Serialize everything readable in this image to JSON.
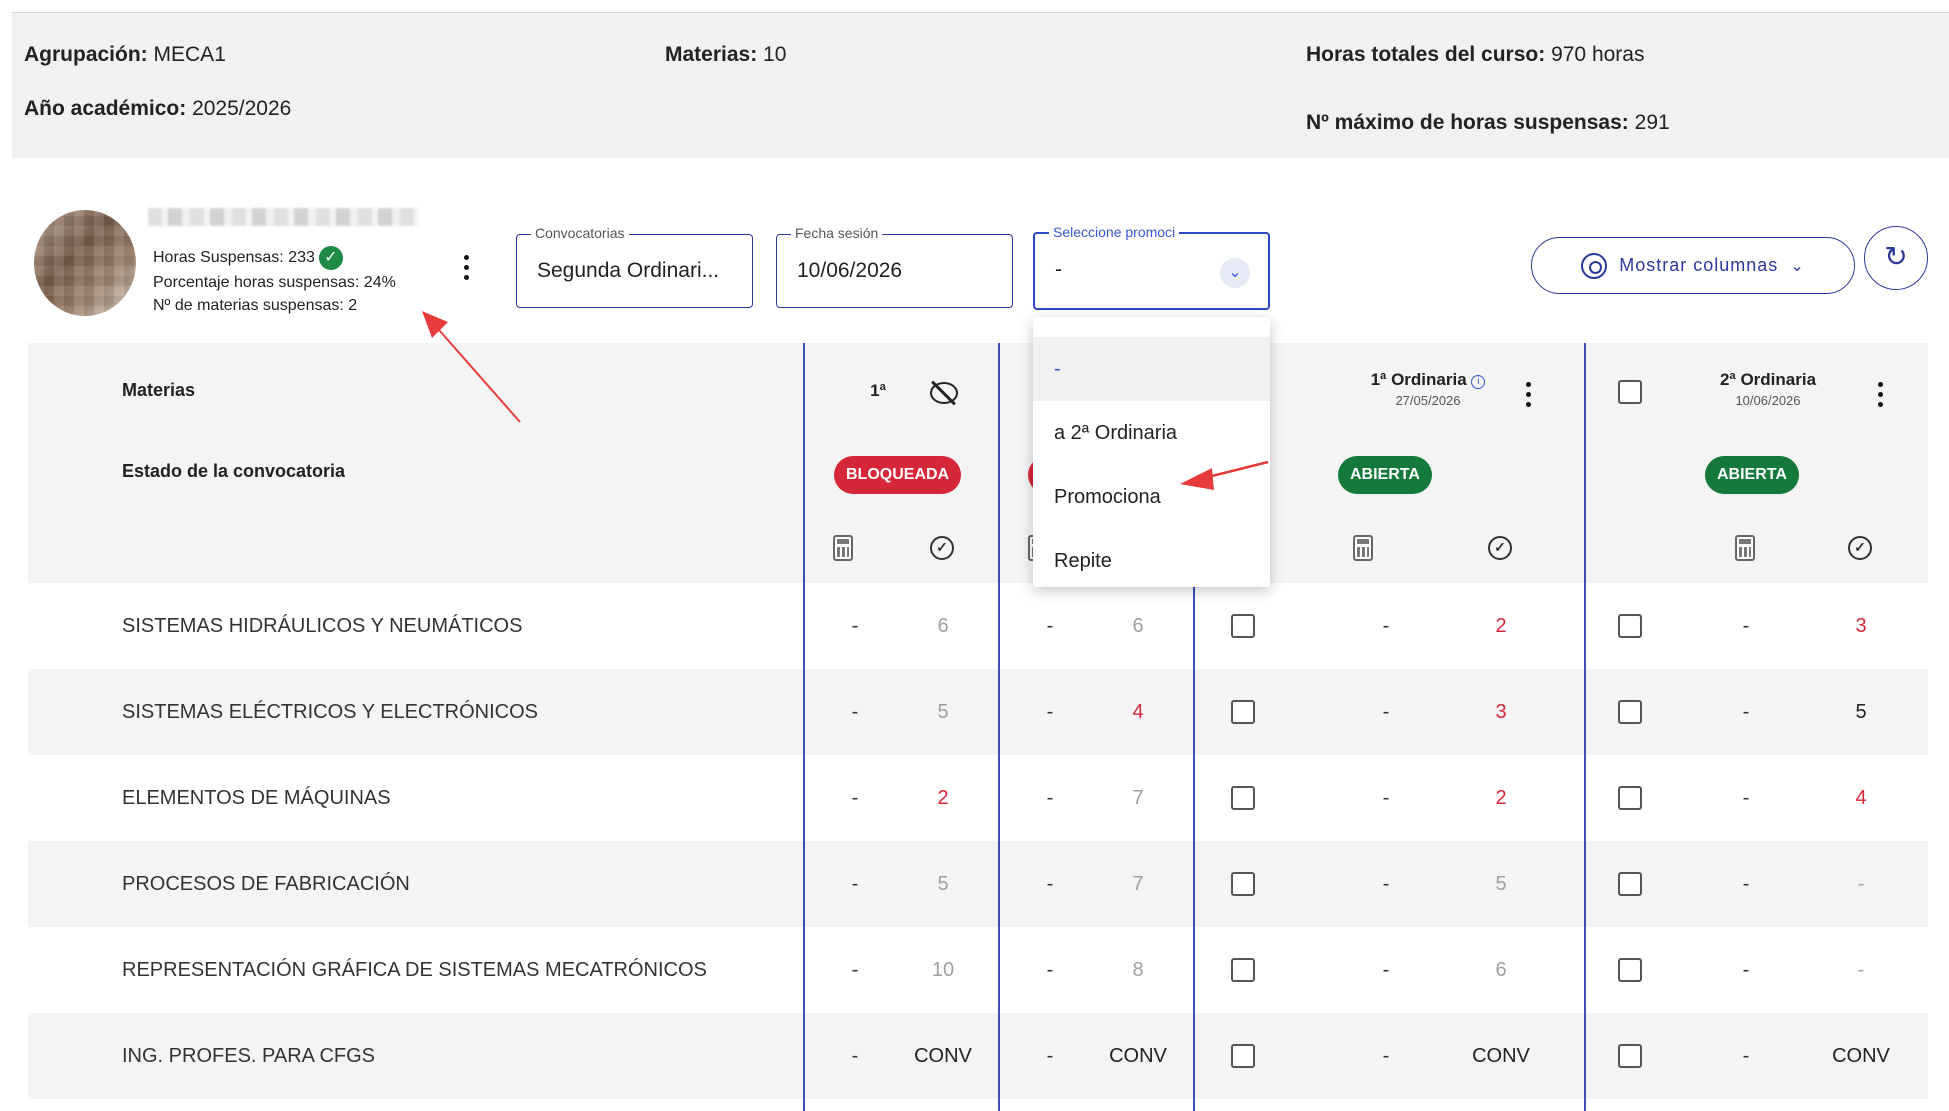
{
  "info": {
    "agrupacion_label": "Agrupación:",
    "agrupacion_value": "MECA1",
    "anio_label": "Año académico:",
    "anio_value": "2025/2026",
    "materias_label": "Materias:",
    "materias_value": "10",
    "horas_totales_label": "Horas totales del curso:",
    "horas_totales_value": "970 horas",
    "max_horas_label": "Nº máximo de horas suspensas:",
    "max_horas_value": "291"
  },
  "student": {
    "horas_suspensas": "Horas Suspensas:  233",
    "porcentaje": "Porcentaje horas suspensas:  24%",
    "materias_suspensas": "Nº de materias suspensas:  2"
  },
  "filters": {
    "convocatorias_label": "Convocatorias",
    "convocatorias_value": "Segunda Ordinari...",
    "fecha_label": "Fecha sesión",
    "fecha_value": "10/06/2026",
    "promo_label": "Seleccione promoci",
    "promo_value": "-"
  },
  "toolbar": {
    "columns_label": "Mostrar columnas"
  },
  "dropdown": {
    "options": [
      "-",
      "a 2ª Ordinaria",
      "Promociona",
      "Repite"
    ]
  },
  "table": {
    "materias_header": "Materias",
    "estado_header": "Estado de la convocatoria",
    "col1_title": "1ª",
    "col3_title": "1ª Ordinaria",
    "col3_date": "27/05/2026",
    "col4_title": "2ª Ordinaria",
    "col4_date": "10/06/2026",
    "badge_bloqueada": "BLOQUEADA",
    "badge_abierta": "ABIERTA",
    "rows": [
      {
        "subject": "SISTEMAS HIDRÁULICOS Y NEUMÁTICOS",
        "c1": "6",
        "c2": "6",
        "c3": "2",
        "c4": "3"
      },
      {
        "subject": "SISTEMAS ELÉCTRICOS Y ELECTRÓNICOS",
        "c1": "5",
        "c2": "4",
        "c3": "3",
        "c4": "5"
      },
      {
        "subject": "ELEMENTOS DE MÁQUINAS",
        "c1": "2",
        "c2": "7",
        "c3": "2",
        "c4": "4"
      },
      {
        "subject": "PROCESOS DE FABRICACIÓN",
        "c1": "5",
        "c2": "7",
        "c3": "5",
        "c4": "-"
      },
      {
        "subject": "REPRESENTACIÓN GRÁFICA DE SISTEMAS MECATRÓNICOS",
        "c1": "10",
        "c2": "8",
        "c3": "6",
        "c4": "-"
      },
      {
        "subject": "ING. PROFES. PARA CFGS",
        "c1": "CONV",
        "c2": "CONV",
        "c3": "CONV",
        "c4": "CONV"
      }
    ],
    "dash": "-"
  },
  "colors": {
    "accent": "#2b3a9a",
    "danger": "#d6273a",
    "success": "#137a3b",
    "annotation": "#e63b3b"
  },
  "icons": [
    "check-circle-icon",
    "kebab-menu-icon",
    "chevron-down-icon",
    "eye-icon",
    "refresh-icon",
    "eye-off-icon",
    "calculator-icon",
    "circle-check-icon",
    "info-icon"
  ]
}
